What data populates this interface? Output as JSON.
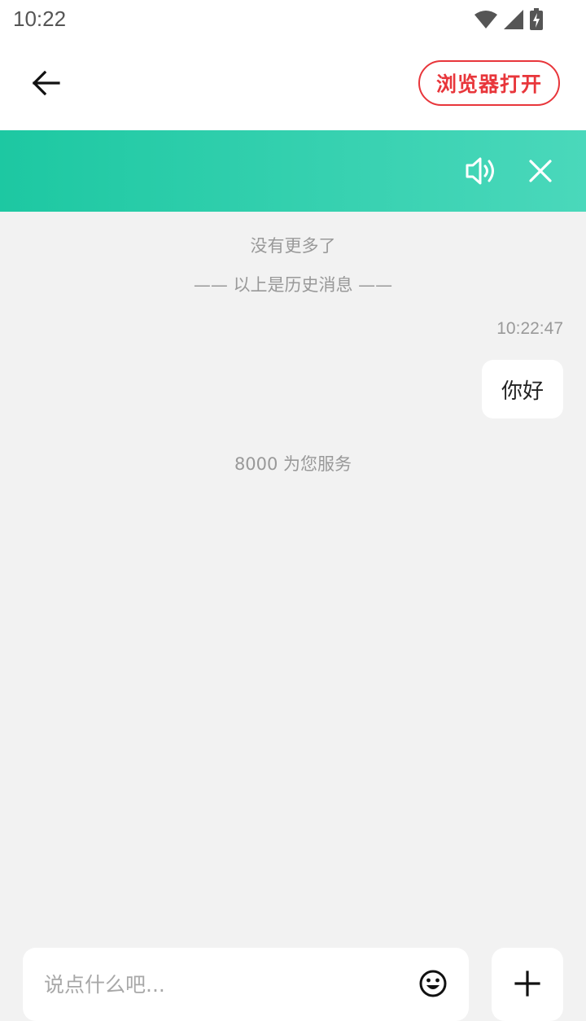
{
  "status_bar": {
    "time": "10:22",
    "icons": [
      "wifi-icon",
      "signal-icon",
      "battery-charging-icon"
    ]
  },
  "nav": {
    "back_icon": "arrow-left-icon",
    "open_in_browser_label": "浏览器打开",
    "accent_color": "#e8363b"
  },
  "banner": {
    "icons": [
      "speaker-icon",
      "close-icon"
    ],
    "gradient": [
      "#1dc8a2",
      "#4ad8bb"
    ]
  },
  "chat": {
    "no_more_text": "没有更多了",
    "history_divider_text": "—— 以上是历史消息 ——",
    "messages": [
      {
        "time": "10:22:47",
        "text": "你好",
        "side": "right"
      }
    ],
    "service_note": "8000 为您服务"
  },
  "composer": {
    "placeholder": "说点什么吧...",
    "value": "",
    "emoji_icon": "smiley-icon",
    "plus_icon": "plus-icon"
  }
}
